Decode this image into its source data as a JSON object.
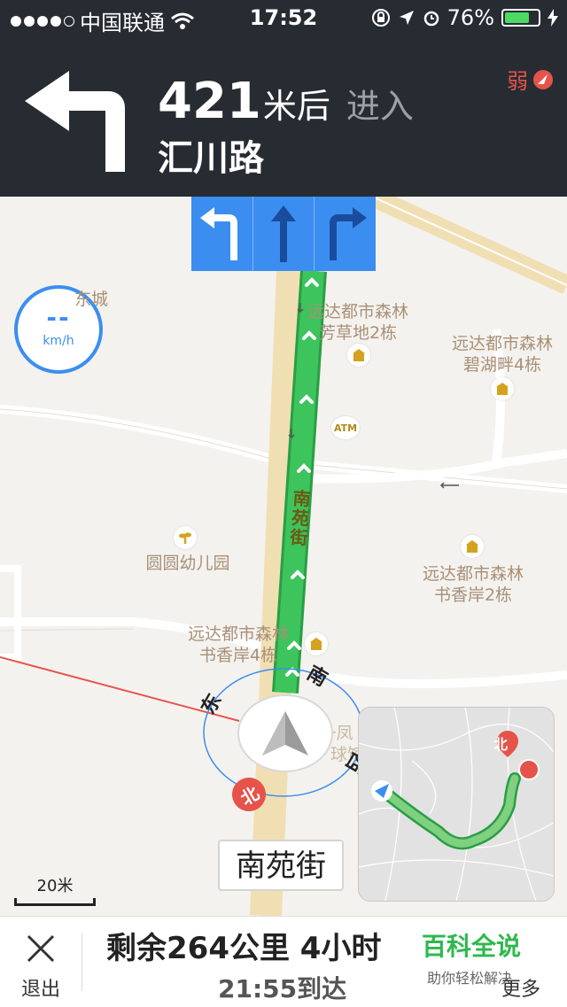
{
  "status_bar": {
    "carrier": "中国联通",
    "time": "17:52",
    "battery": "76%",
    "battery_level": 0.76,
    "signal_bars_filled": 4
  },
  "navigation": {
    "turn_icon": "turn-left-arrow-icon",
    "distance": "421",
    "unit": "米后",
    "action": "进入",
    "road": "汇川路",
    "gps_signal": "弱"
  },
  "lanes": [
    "turn-left-lane-icon",
    "straight-lane-icon",
    "turn-right-lane-icon"
  ],
  "speed": {
    "value": "--",
    "unit": "km/h"
  },
  "map": {
    "current_street_vertical": "南苑街",
    "pois": [
      {
        "line1": "远达都市森林",
        "line2": "芳草地2栋"
      },
      {
        "line1": "远达都市森林",
        "line2": "碧湖畔4栋"
      },
      {
        "line1": "圆圆幼儿园",
        "line2": ""
      },
      {
        "line1": "远达都市森林",
        "line2": "书香岸2栋"
      },
      {
        "line1": "远达都市森林",
        "line2": "书香岸4栋"
      }
    ],
    "poi_partial_top_left": "东城",
    "atm_label": "ATM",
    "directions": {
      "east": "东",
      "south": "南",
      "west": "西",
      "north": "北"
    },
    "behind_text": "贡一凤 羽毛球馆",
    "scale": "20米",
    "street_label": "南苑街",
    "overview_north": "北"
  },
  "bottom": {
    "exit_label": "退出",
    "remaining": "剩余264公里 4小时",
    "arrival": "21:55到达",
    "ad_title": "百科全说",
    "ad_sub": "助你轻松解决",
    "more_label": "更多"
  },
  "colors": {
    "route": "#3dc45c",
    "accent_blue": "#3b8ef0",
    "header_bg": "#272c33",
    "alert_red": "#e5534b"
  }
}
